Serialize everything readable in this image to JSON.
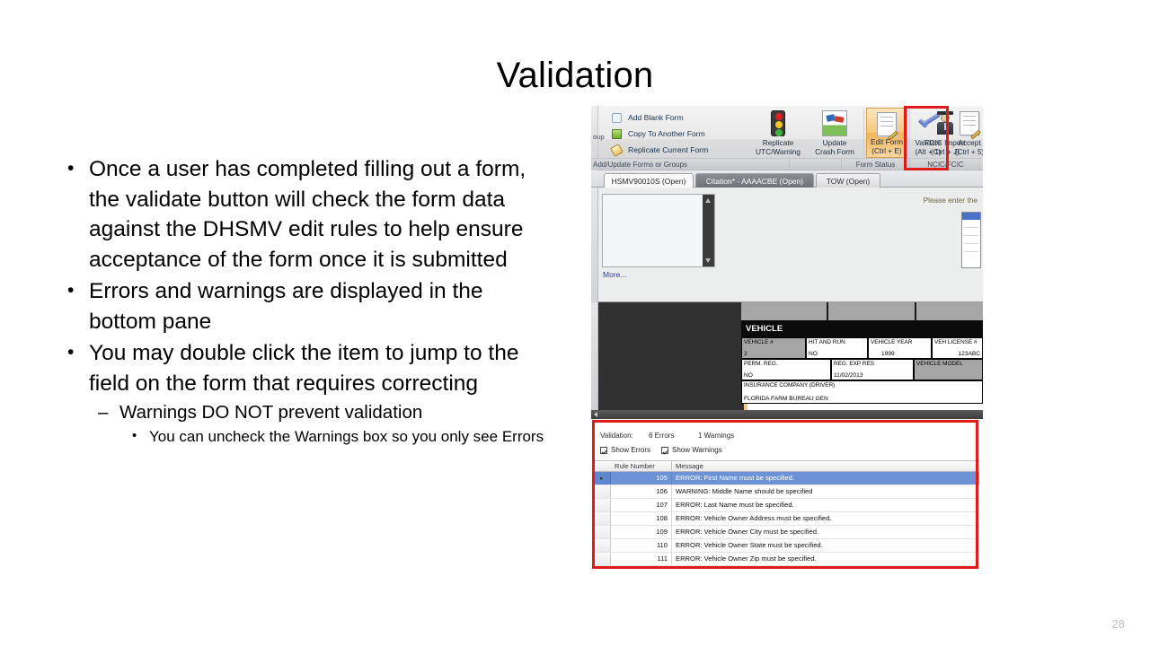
{
  "slide": {
    "title": "Validation",
    "page_number": "28",
    "bullets": [
      "Once a user has completed filling out a form, the validate button will check the form data against the DHSMV edit rules to help ensure acceptance of the form once it is submitted",
      "Errors and warnings are displayed in the bottom pane",
      "You may double click the item to jump to the field on the form that requires correcting"
    ],
    "sub_bullet": "Warnings DO NOT prevent validation",
    "sub_sub_bullet": "You can uncheck the Warnings box so you only see Errors"
  },
  "screenshot": {
    "ribbon": {
      "left_group_label": "oup",
      "small_commands": [
        {
          "label": "Add Blank Form",
          "icon": "add-blank-form-icon"
        },
        {
          "label": "Copy To Another Form",
          "icon": "copy-to-another-form-icon"
        },
        {
          "label": "Replicate Current Form",
          "icon": "replicate-current-form-icon"
        }
      ],
      "big_buttons": [
        {
          "line1": "Replicate",
          "line2": "UTC/Warning",
          "icon": "traffic-light-icon"
        },
        {
          "line1": "Update",
          "line2": "Crash Form",
          "icon": "crash-form-icon"
        },
        {
          "line1": "Edit Form",
          "line2": "(Ctrl + E)",
          "icon": "edit-document-icon"
        },
        {
          "line1": "Validate",
          "line2": "(Alt + 1)",
          "icon": "validate-check-icon"
        },
        {
          "line1": "Accept",
          "line2": "(Ctrl + 5)",
          "icon": "accept-document-icon"
        },
        {
          "line1": "FCIC Import",
          "line2": "(Ctrl + J)",
          "icon": "fcic-person-icon"
        }
      ],
      "group_labels": [
        "Add/Update Forms or Groups",
        "",
        "Form Status",
        "NCIC/FCIC"
      ]
    },
    "tabs": [
      {
        "label": "HSMV90010S (Open)",
        "state": "active"
      },
      {
        "label": "Citation* - AAAACBE (Open)",
        "state": "selected-dark"
      },
      {
        "label": "TOW (Open)",
        "state": "inactive"
      }
    ],
    "editor": {
      "more_link": "More...",
      "prompt": "Please enter the"
    },
    "form": {
      "section_title": "VEHICLE",
      "fields": [
        {
          "key": "VEHICLE #",
          "value": "2"
        },
        {
          "key": "HIT AND RUN",
          "value": "NO"
        },
        {
          "key": "VEHICLE YEAR",
          "value": "1999"
        },
        {
          "key": "VEH LICENSE #",
          "value": "123ABC"
        },
        {
          "key": "PERM. REG.",
          "value": "NO"
        },
        {
          "key": "REG. EXP RES",
          "value": "11/02/2013"
        },
        {
          "key": "VEHICLE MODEL",
          "value": ""
        },
        {
          "key": "INSURANCE COMPANY (DRIVER)",
          "value": "FLORIDA FARM BUREAU GEN"
        }
      ]
    },
    "validation": {
      "title_label": "Validation:",
      "error_count": "6 Errors",
      "warning_count": "1 Warnings",
      "show_errors_label": "Show Errors",
      "show_warnings_label": "Show Warnings",
      "show_errors_checked": true,
      "show_warnings_checked": true,
      "columns": [
        "Rule Number",
        "Message"
      ],
      "rows": [
        {
          "rule": "105",
          "message": "ERROR: First Name must be specified.",
          "selected": true
        },
        {
          "rule": "106",
          "message": "WARNING: Middle Name should be specified",
          "selected": false
        },
        {
          "rule": "107",
          "message": "ERROR: Last Name must be specified.",
          "selected": false
        },
        {
          "rule": "108",
          "message": "ERROR: Vehicle Owner Address must be specified.",
          "selected": false
        },
        {
          "rule": "109",
          "message": "ERROR: Vehicle Owner City must be specified.",
          "selected": false
        },
        {
          "rule": "110",
          "message": "ERROR: Vehicle Owner State must be specified.",
          "selected": false
        },
        {
          "rule": "111",
          "message": "ERROR: Vehicle Owner Zip must be specified.",
          "selected": false
        }
      ]
    },
    "highlight_color": "#e01b1b"
  }
}
